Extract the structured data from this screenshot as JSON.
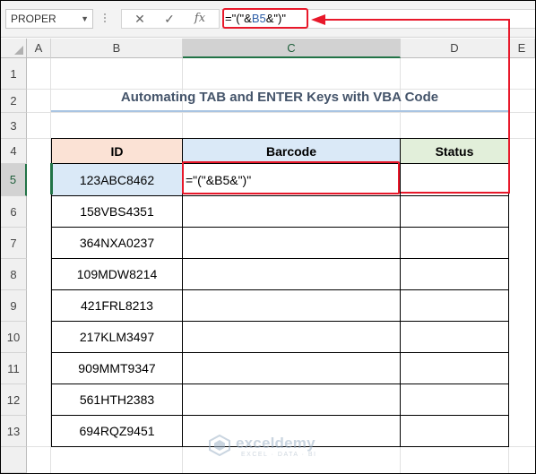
{
  "formula_bar": {
    "name_box": "PROPER",
    "cancel_glyph": "✕",
    "enter_glyph": "✓",
    "fx_label": "fx",
    "formula_part1": "=\"(\"&",
    "formula_ref": "B5",
    "formula_part2": "&\")\""
  },
  "columns": [
    "A",
    "B",
    "C",
    "D",
    "E"
  ],
  "rows": [
    "1",
    "2",
    "3",
    "4",
    "5",
    "6",
    "7",
    "8",
    "9",
    "10",
    "11",
    "12",
    "13"
  ],
  "title": "Automating TAB and ENTER Keys with VBA Code",
  "table": {
    "headers": [
      "ID",
      "Barcode",
      "Status"
    ],
    "ids": [
      "123ABC8462",
      "158VBS4351",
      "364NXA0237",
      "109MDW8214",
      "421FRL8213",
      "217KLM3497",
      "909MMT9347",
      "561HTH2383",
      "694RQZ9451"
    ],
    "editing_cell": "=\"(\"&B5&\")\""
  },
  "watermark": {
    "name": "exceldemy",
    "tagline": "EXCEL · DATA · BI"
  },
  "colors": {
    "annotation_red": "#e8182a",
    "id_header_bg": "#fbe2d5",
    "barcode_header_bg": "#dae9f7",
    "status_header_bg": "#e2efda",
    "title_color": "#44546a",
    "excel_green": "#217346"
  },
  "icons": [
    "dropdown-arrow-icon",
    "cancel-icon",
    "enter-icon",
    "fx-icon",
    "select-all-icon",
    "exceldemy-logo-icon"
  ]
}
